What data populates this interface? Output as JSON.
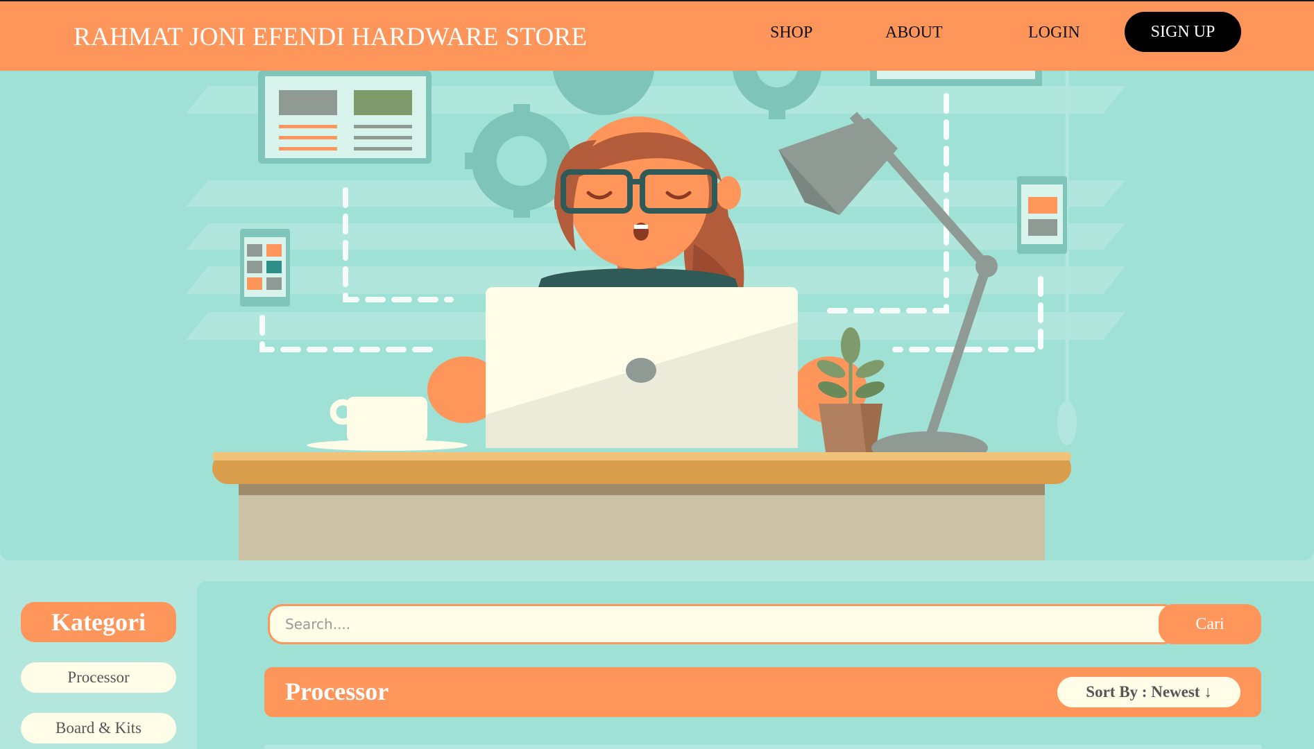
{
  "navbar": {
    "brand": "RAHMAT JONI EFENDI HARDWARE STORE",
    "links": [
      "SHOP",
      "ABOUT",
      "LOGIN"
    ],
    "signup_label": "SIGN UP"
  },
  "hero": {
    "illustration": "woman-working-on-laptop-at-desk"
  },
  "sidebar": {
    "title": "Kategori",
    "items": [
      "Processor",
      "Board & Kits"
    ]
  },
  "search": {
    "placeholder": "Search....",
    "value": "",
    "button_label": "Cari"
  },
  "category": {
    "heading": "Processor",
    "sort_label": "Sort By : Newest ↓"
  },
  "colors": {
    "accent": "#fe955a",
    "background": "#b3e7de",
    "panel": "#9fe2d5",
    "cream": "#fffde8",
    "dark": "#000000"
  }
}
